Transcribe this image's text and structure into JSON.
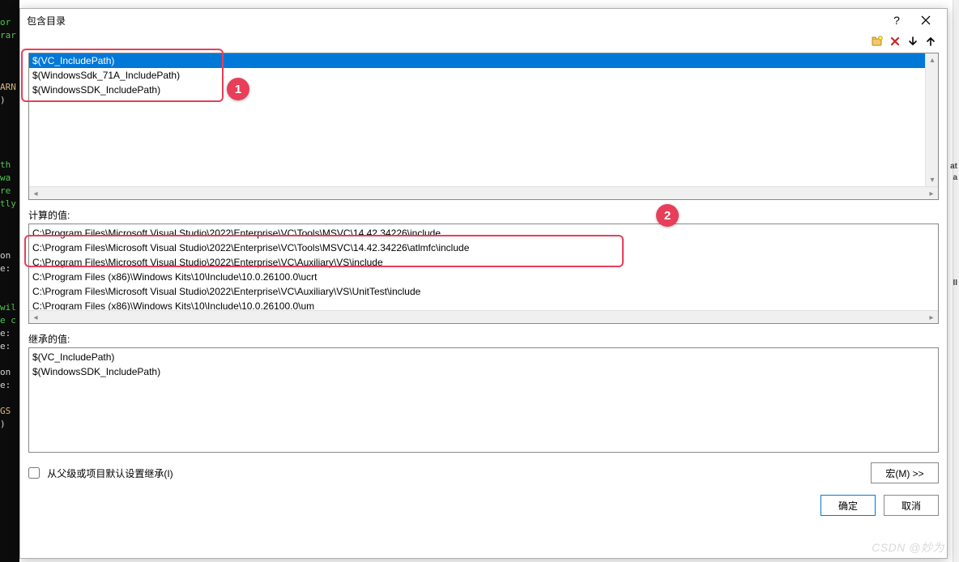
{
  "dialog": {
    "title": "包含目录",
    "help_tooltip": "?",
    "close_tooltip": "关闭"
  },
  "toolbar": {
    "new_folder": "新建行",
    "delete": "删除",
    "move_down": "下移",
    "move_up": "上移"
  },
  "entries": [
    {
      "text": "$(VC_IncludePath)",
      "selected": true
    },
    {
      "text": "$(WindowsSdk_71A_IncludePath)",
      "selected": false
    },
    {
      "text": "$(WindowsSDK_IncludePath)",
      "selected": false
    }
  ],
  "calc": {
    "label": "计算的值:",
    "values": [
      "C:\\Program Files\\Microsoft Visual Studio\\2022\\Enterprise\\VC\\Tools\\MSVC\\14.42.34226\\include",
      "C:\\Program Files\\Microsoft Visual Studio\\2022\\Enterprise\\VC\\Tools\\MSVC\\14.42.34226\\atlmfc\\include",
      "C:\\Program Files\\Microsoft Visual Studio\\2022\\Enterprise\\VC\\Auxiliary\\VS\\include",
      "C:\\Program Files (x86)\\Windows Kits\\10\\Include\\10.0.26100.0\\ucrt",
      "C:\\Program Files\\Microsoft Visual Studio\\2022\\Enterprise\\VC\\Auxiliary\\VS\\UnitTest\\include",
      "C:\\Program Files (x86)\\Windows Kits\\10\\Include\\10.0.26100.0\\um"
    ]
  },
  "inherit": {
    "label": "继承的值:",
    "values": [
      "$(VC_IncludePath)",
      "$(WindowsSDK_IncludePath)"
    ]
  },
  "checkbox": {
    "label": "从父级或项目默认设置继承(I)",
    "checked": false
  },
  "buttons": {
    "macros": "宏(M) >>",
    "ok": "确定",
    "cancel": "取消"
  },
  "annotations": {
    "badge1": "1",
    "badge2": "2"
  },
  "bg_code_fragments": [
    "or",
    "rar",
    "ARN",
    ")",
    "th",
    "wa",
    "re",
    "tly",
    "on",
    "e:",
    "wil",
    "e c",
    "e:",
    "e:",
    "on",
    "e:",
    "GS",
    ")"
  ],
  "right_markers": [
    "at",
    "a",
    "II"
  ],
  "watermark": "CSDN @妙为"
}
